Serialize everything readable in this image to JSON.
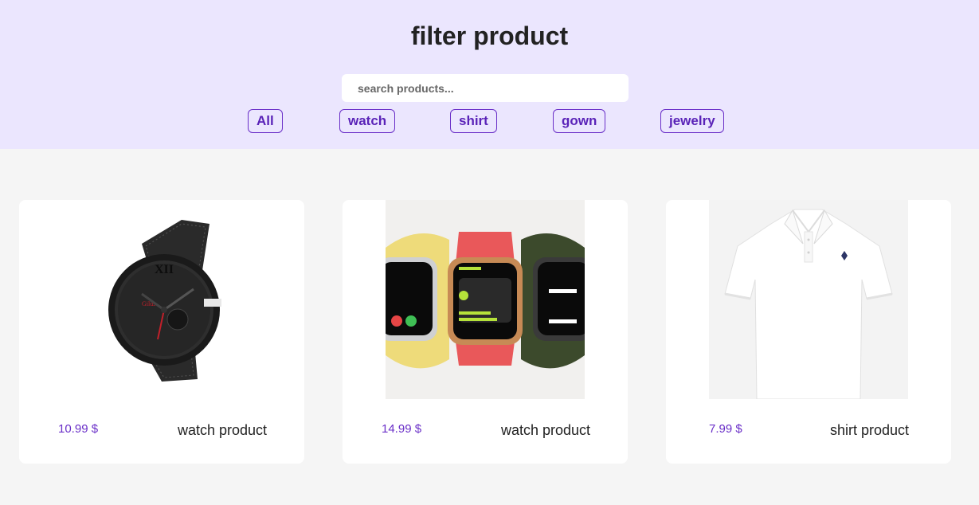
{
  "header": {
    "title": "filter product",
    "search_placeholder": "search products..."
  },
  "filters": [
    {
      "label": "All"
    },
    {
      "label": "watch"
    },
    {
      "label": "shirt"
    },
    {
      "label": "gown"
    },
    {
      "label": "jewelry"
    }
  ],
  "products": [
    {
      "price": "10.99 $",
      "name": "watch product",
      "image": "black-watch-image"
    },
    {
      "price": "14.99 $",
      "name": "watch product",
      "image": "smartwatch-image"
    },
    {
      "price": "7.99 $",
      "name": "shirt product",
      "image": "white-polo-shirt-image"
    }
  ],
  "colors": {
    "header_bg": "#ebe6fe",
    "accent": "#6a2fc8",
    "page_bg": "#f5f5f5"
  }
}
